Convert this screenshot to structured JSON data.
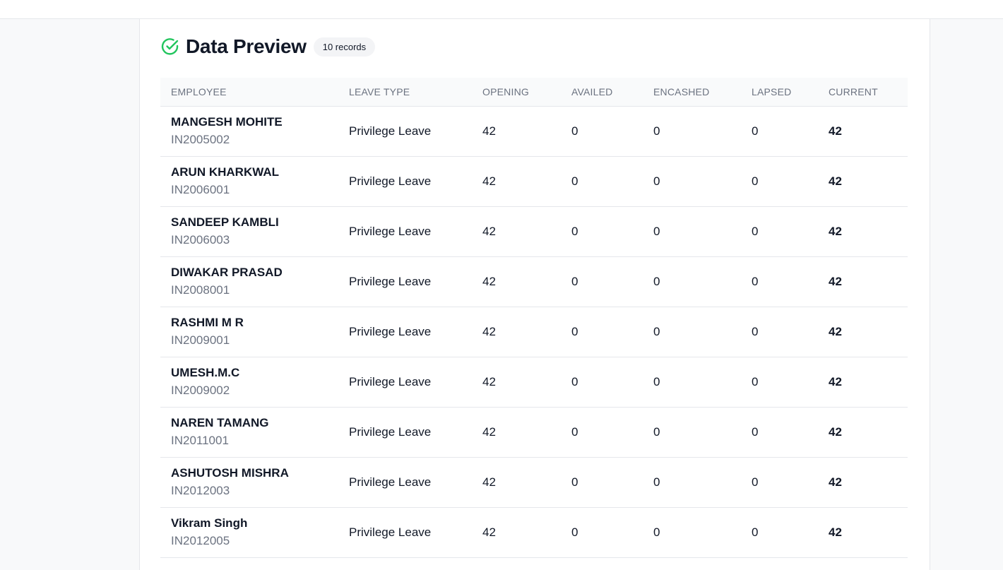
{
  "header": {
    "title": "Data Preview",
    "badge": "10 records"
  },
  "colors": {
    "accent_green": "#22c55e",
    "header_text": "#6b7280"
  },
  "table": {
    "columns": [
      "EMPLOYEE",
      "LEAVE TYPE",
      "OPENING",
      "AVAILED",
      "ENCASHED",
      "LAPSED",
      "CURRENT"
    ],
    "rows": [
      {
        "name": "MANGESH MOHITE",
        "id": "IN2005002",
        "leave_type": "Privilege Leave",
        "opening": "42",
        "availed": "0",
        "encashed": "0",
        "lapsed": "0",
        "current": "42"
      },
      {
        "name": "ARUN KHARKWAL",
        "id": "IN2006001",
        "leave_type": "Privilege Leave",
        "opening": "42",
        "availed": "0",
        "encashed": "0",
        "lapsed": "0",
        "current": "42"
      },
      {
        "name": "SANDEEP KAMBLI",
        "id": "IN2006003",
        "leave_type": "Privilege Leave",
        "opening": "42",
        "availed": "0",
        "encashed": "0",
        "lapsed": "0",
        "current": "42"
      },
      {
        "name": "DIWAKAR PRASAD",
        "id": "IN2008001",
        "leave_type": "Privilege Leave",
        "opening": "42",
        "availed": "0",
        "encashed": "0",
        "lapsed": "0",
        "current": "42"
      },
      {
        "name": "RASHMI M R",
        "id": "IN2009001",
        "leave_type": "Privilege Leave",
        "opening": "42",
        "availed": "0",
        "encashed": "0",
        "lapsed": "0",
        "current": "42"
      },
      {
        "name": "UMESH.M.C",
        "id": "IN2009002",
        "leave_type": "Privilege Leave",
        "opening": "42",
        "availed": "0",
        "encashed": "0",
        "lapsed": "0",
        "current": "42"
      },
      {
        "name": "NAREN TAMANG",
        "id": "IN2011001",
        "leave_type": "Privilege Leave",
        "opening": "42",
        "availed": "0",
        "encashed": "0",
        "lapsed": "0",
        "current": "42"
      },
      {
        "name": "ASHUTOSH MISHRA",
        "id": "IN2012003",
        "leave_type": "Privilege Leave",
        "opening": "42",
        "availed": "0",
        "encashed": "0",
        "lapsed": "0",
        "current": "42"
      },
      {
        "name": "Vikram Singh",
        "id": "IN2012005",
        "leave_type": "Privilege Leave",
        "opening": "42",
        "availed": "0",
        "encashed": "0",
        "lapsed": "0",
        "current": "42"
      }
    ]
  }
}
